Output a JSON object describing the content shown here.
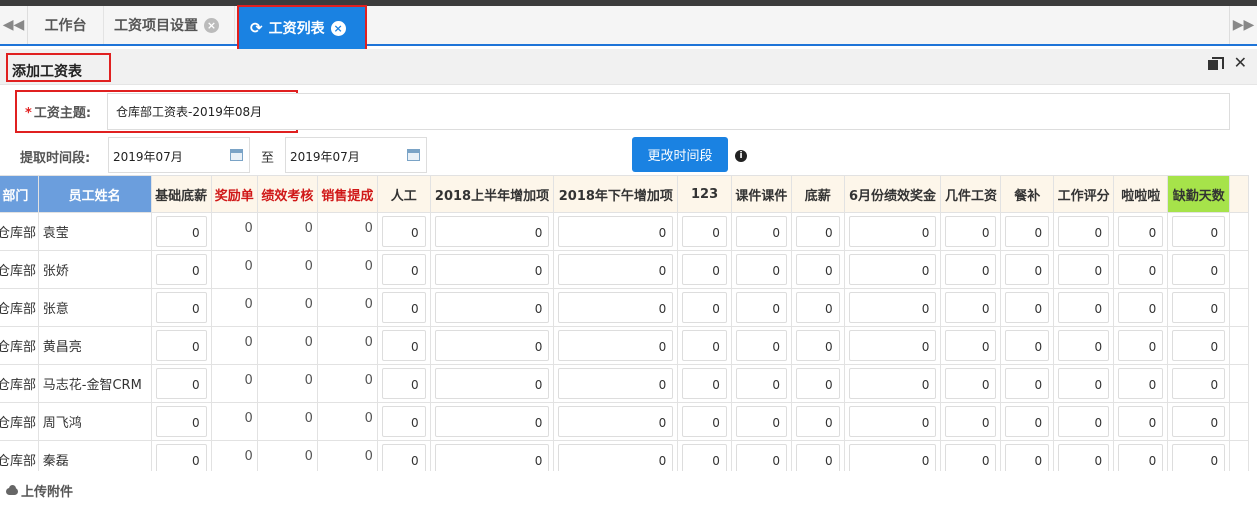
{
  "tabs": {
    "items": [
      {
        "label": "工作台"
      },
      {
        "label": "工资项目设置"
      },
      {
        "label": "工资列表"
      }
    ]
  },
  "panel": {
    "title": "添加工资表"
  },
  "form": {
    "subject_label": "工资主题:",
    "subject_value": "仓库部工资表-2019年08月",
    "time_label": "提取时间段:",
    "start_date": "2019年07月",
    "to_label": "至",
    "end_date": "2019年07月",
    "change_button": "更改时间段"
  },
  "table": {
    "headers": [
      "部门",
      "员工姓名",
      "基础底薪",
      "奖励单",
      "绩效考核",
      "销售提成",
      "人工",
      "2018上半年增加项",
      "2018年下午增加项",
      "123",
      "课件课件",
      "底薪",
      "6月份绩效奖金",
      "几件工资",
      "餐补",
      "工作评分",
      "啦啦啦",
      "缺勤天数"
    ],
    "rows": [
      {
        "dept": "仓库部",
        "name": "袁莹",
        "v": [
          "0",
          "0",
          "0",
          "0",
          "0",
          "0",
          "0",
          "0",
          "0",
          "0",
          "0",
          "0",
          "0",
          "0",
          "0",
          "0"
        ]
      },
      {
        "dept": "仓库部",
        "name": "张娇",
        "v": [
          "0",
          "0",
          "0",
          "0",
          "0",
          "0",
          "0",
          "0",
          "0",
          "0",
          "0",
          "0",
          "0",
          "0",
          "0",
          "0"
        ]
      },
      {
        "dept": "仓库部",
        "name": "张意",
        "v": [
          "0",
          "0",
          "0",
          "0",
          "0",
          "0",
          "0",
          "0",
          "0",
          "0",
          "0",
          "0",
          "0",
          "0",
          "0",
          "0"
        ]
      },
      {
        "dept": "仓库部",
        "name": "黄昌亮",
        "v": [
          "0",
          "0",
          "0",
          "0",
          "0",
          "0",
          "0",
          "0",
          "0",
          "0",
          "0",
          "0",
          "0",
          "0",
          "0",
          "0"
        ]
      },
      {
        "dept": "仓库部",
        "name": "马志花-金智CRM",
        "v": [
          "0",
          "0",
          "0",
          "0",
          "0",
          "0",
          "0",
          "0",
          "0",
          "0",
          "0",
          "0",
          "0",
          "0",
          "0",
          "0"
        ]
      },
      {
        "dept": "仓库部",
        "name": "周飞鸿",
        "v": [
          "0",
          "0",
          "0",
          "0",
          "0",
          "0",
          "0",
          "0",
          "0",
          "0",
          "0",
          "0",
          "0",
          "0",
          "0",
          "0"
        ]
      },
      {
        "dept": "仓库部",
        "name": "秦磊",
        "v": [
          "0",
          "0",
          "0",
          "0",
          "0",
          "0",
          "0",
          "0",
          "0",
          "0",
          "0",
          "0",
          "0",
          "0",
          "0",
          "0"
        ]
      }
    ]
  },
  "upload": {
    "label": "上传附件"
  }
}
